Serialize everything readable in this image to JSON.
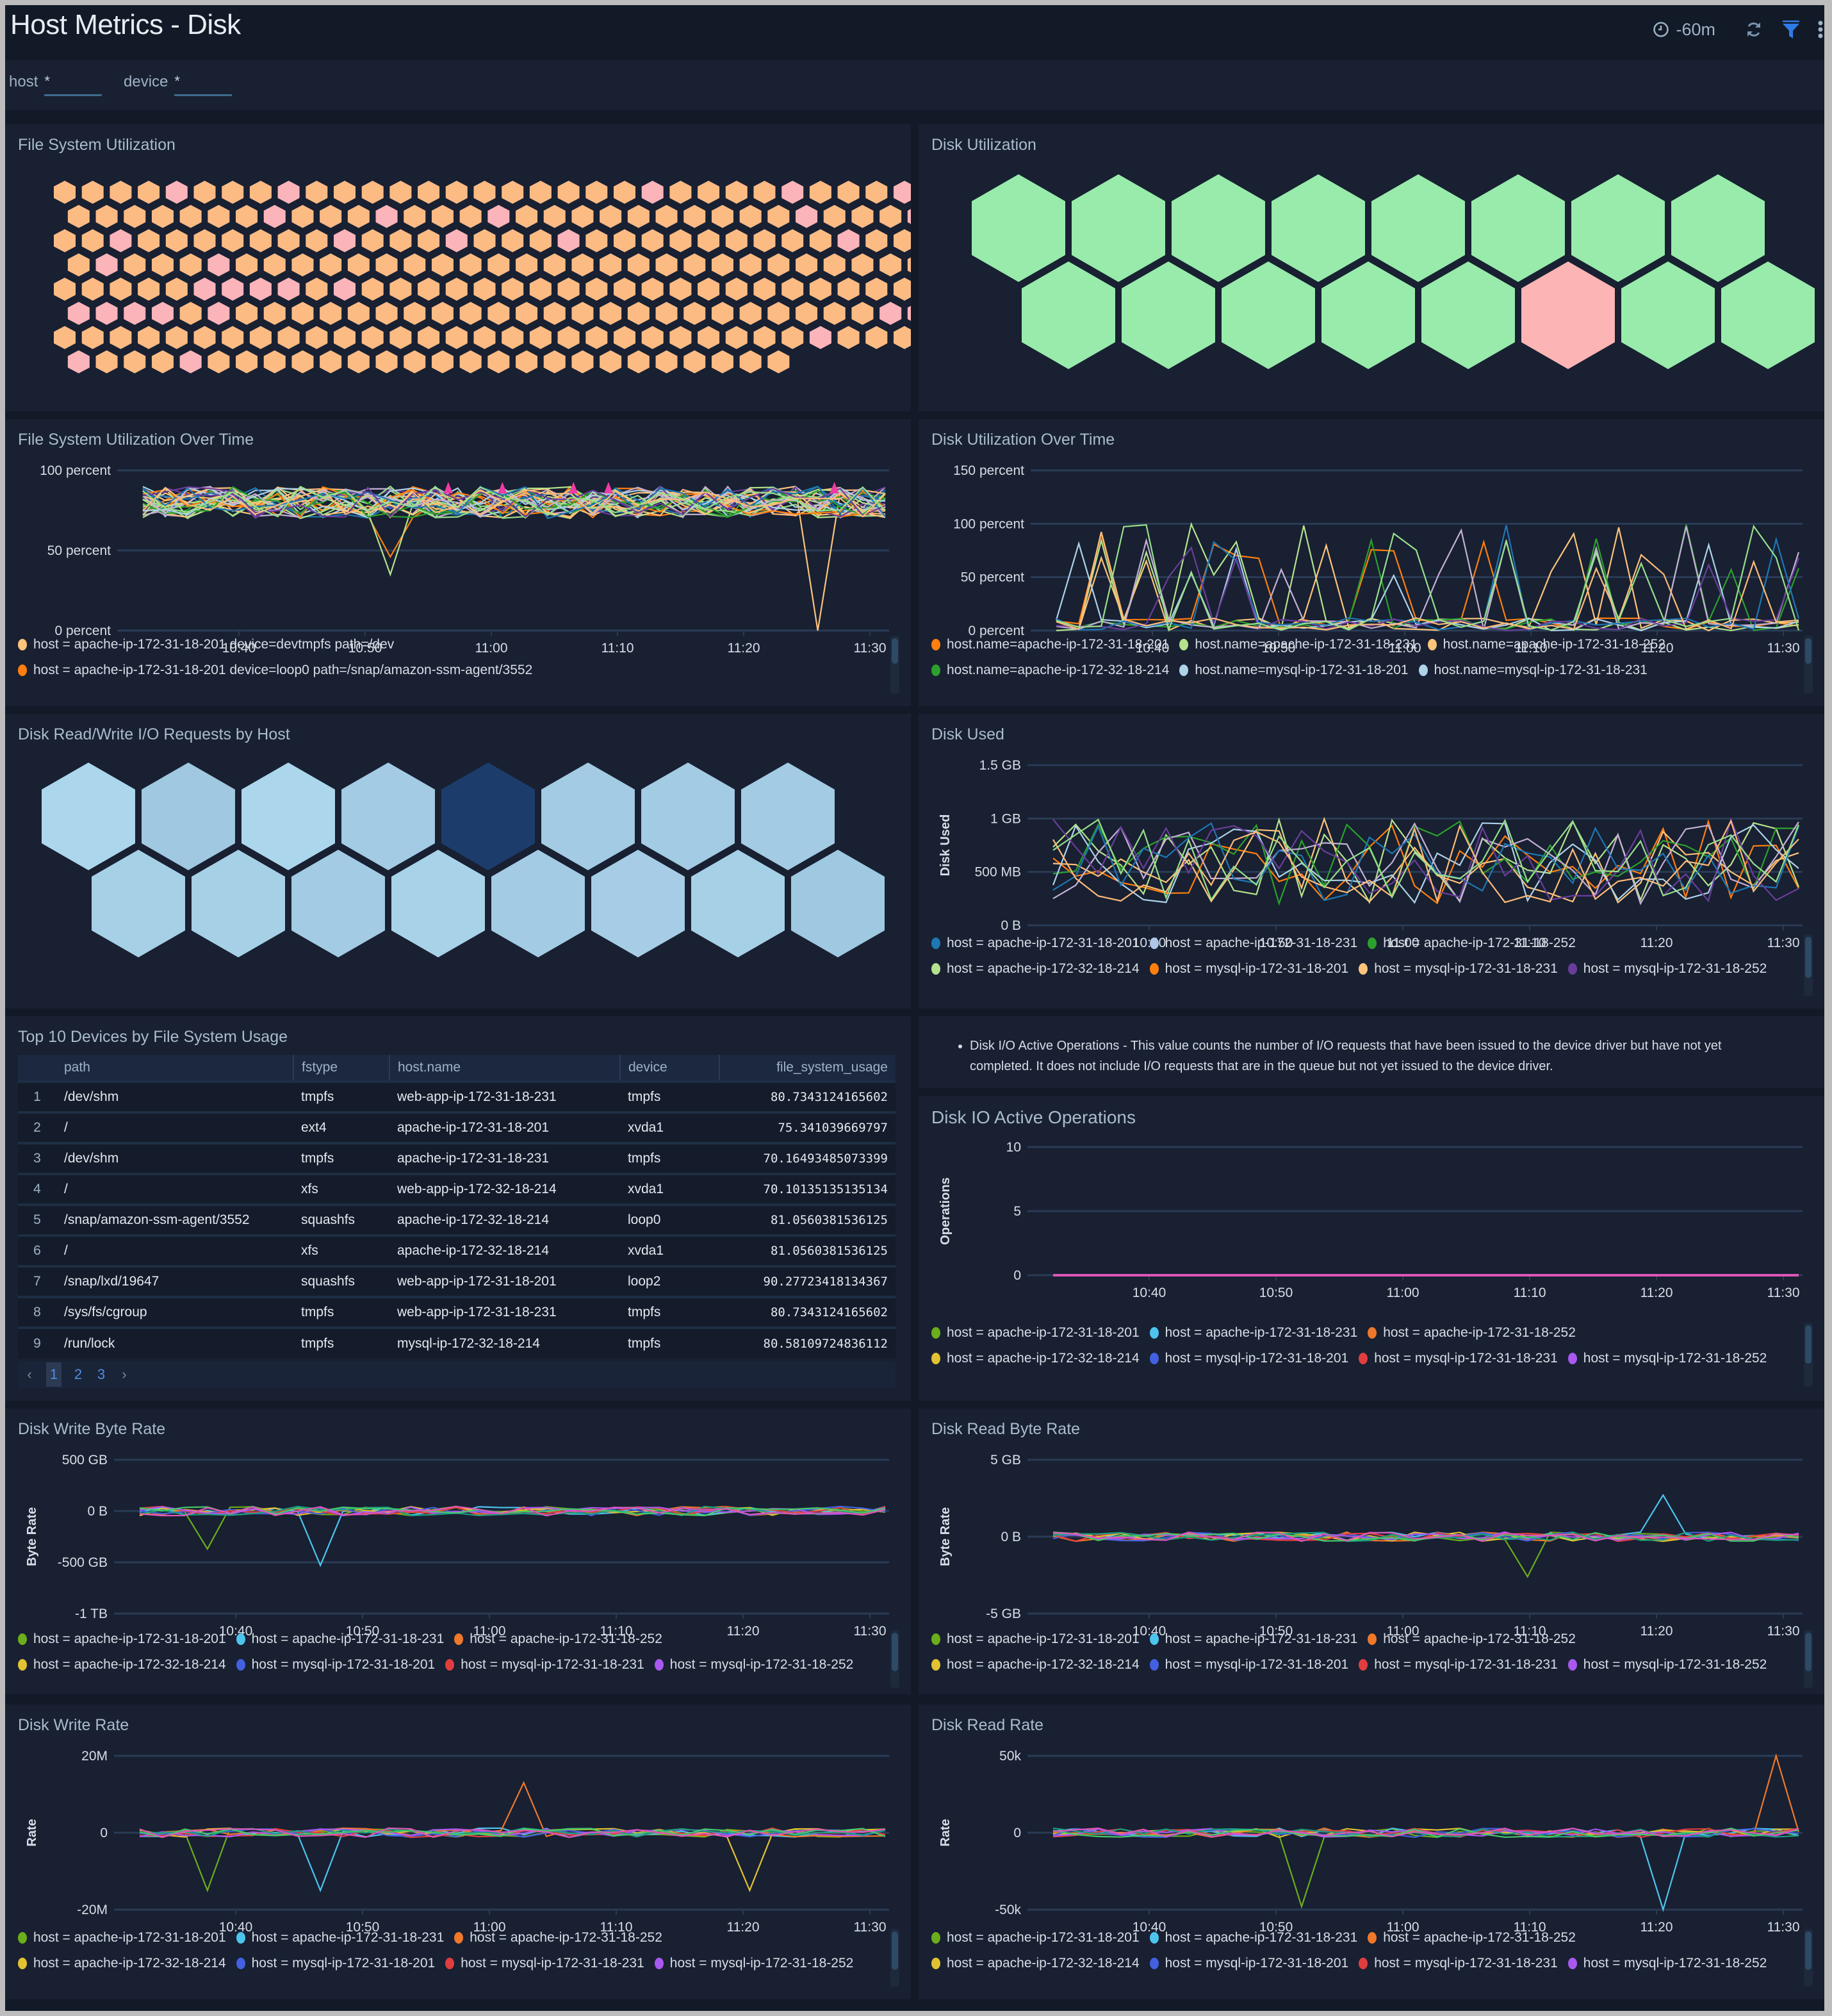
{
  "header": {
    "title": "Host Metrics - Disk",
    "time_range": "-60m",
    "icons": [
      "clock-icon",
      "refresh-icon",
      "filter-icon",
      "more-icon"
    ],
    "filter_color": "#2f7be6"
  },
  "filters": [
    {
      "label": "host",
      "value": "*"
    },
    {
      "label": "device",
      "value": "*"
    }
  ],
  "panels": {
    "fs_util": {
      "title": "File System Utilization",
      "colors": {
        "normal": "#fdbb84",
        "high": "#fbb4b9"
      },
      "rows": [
        "nnnnhnnnhnnnnnnnnnnnnhnnnnhnnnh",
        "nnnnnnnhnnnhnnnhnnnnnnnnnnhnnnhn",
        "nnhnnnnnnnhnnnhnnnhnnnnnnnnnhnn",
        "nhnnnhnnnnnnnnnnnnnnnnnnnnnnnnnn",
        "nnnnnhhhhnhnnnnnnnnnnnnnnnnnnnn",
        "hhhhnhnnnnnnnnnnnnnnnnnnnnnnnhh",
        "nnnnnnnnnnnnnnnnnnnnnnnnnnnhnnn",
        "hnnnhnnnnnnnnnnnnnnnnnnnnn"
      ]
    },
    "disk_util": {
      "title": "Disk Utilization",
      "colors": {
        "normal": "#98ebab",
        "high": "#fdb4b5"
      },
      "rows": [
        "nnnnnnnn",
        "nnnnnhnn"
      ]
    },
    "fs_util_time": {
      "title": "File System Utilization Over Time",
      "legend": [
        [
          {
            "label": "host = apache-ip-172-31-18-201 device=devtmpfs path=/dev",
            "color": "#fdc47b"
          }
        ],
        [
          {
            "label": "host = apache-ip-172-31-18-201 device=loop0 path=/snap/amazon-ssm-agent/3552",
            "color": "#ff7f0e"
          }
        ]
      ]
    },
    "disk_util_time": {
      "title": "Disk Utilization Over Time",
      "legend": [
        [
          {
            "label": "host.name=apache-ip-172-31-18-201",
            "color": "#ff7f0e"
          },
          {
            "label": "host.name=apache-ip-172-31-18-231",
            "color": "#b5e28c"
          },
          {
            "label": "host.name=apache-ip-172-31-18-252",
            "color": "#fdc47b"
          }
        ],
        [
          {
            "label": "host.name=apache-ip-172-32-18-214",
            "color": "#2ca02c"
          },
          {
            "label": "host.name=mysql-ip-172-31-18-201",
            "color": "#aed3e9"
          },
          {
            "label": "host.name=mysql-ip-172-31-18-231",
            "color": "#aed3e9"
          }
        ]
      ]
    },
    "io_requests": {
      "title": "Disk Read/Write I/O Requests by Host",
      "rows": [
        [
          "#acd6ec",
          "#a0c8e0",
          "#acd6ec",
          "#a3cbe3",
          "#1c3d6b",
          "#a3cbe3",
          "#a3cbe3",
          "#a3cbe3"
        ],
        [
          "#a6d0e6",
          "#a6d0e6",
          "#a3cbe3",
          "#a8d2e8",
          "#a3cbe3",
          "#a6cde5",
          "#a6d0e6",
          "#9fc9e0"
        ]
      ]
    },
    "disk_used": {
      "title": "Disk Used",
      "legend": [
        [
          {
            "label": "host = apache-ip-172-31-18-201",
            "color": "#1f77b4"
          },
          {
            "label": "host = apache-ip-172-31-18-231",
            "color": "#aec7e8"
          },
          {
            "label": "host = apache-ip-172-31-18-252",
            "color": "#2ca02c"
          }
        ],
        [
          {
            "label": "host = apache-ip-172-32-18-214",
            "color": "#b5e28c"
          },
          {
            "label": "host = mysql-ip-172-31-18-201",
            "color": "#ff7f0e"
          },
          {
            "label": "host = mysql-ip-172-31-18-231",
            "color": "#fdc47b"
          },
          {
            "label": "host = mysql-ip-172-31-18-252",
            "color": "#6a3d9a"
          }
        ]
      ]
    },
    "top_devices": {
      "title": "Top 10 Devices by File System Usage",
      "columns": [
        "",
        "path",
        "fstype",
        "host.name",
        "device",
        "file_system_usage"
      ],
      "rows": [
        [
          "1",
          "/dev/shm",
          "tmpfs",
          "web-app-ip-172-31-18-231",
          "tmpfs",
          "80.7343124165602"
        ],
        [
          "2",
          "/",
          "ext4",
          "apache-ip-172-31-18-201",
          "xvda1",
          "75.341039669797"
        ],
        [
          "3",
          "/dev/shm",
          "tmpfs",
          "apache-ip-172-31-18-231",
          "tmpfs",
          "70.16493485073399"
        ],
        [
          "4",
          "/",
          "xfs",
          "web-app-ip-172-32-18-214",
          "xvda1",
          "70.10135135135134"
        ],
        [
          "5",
          "/snap/amazon-ssm-agent/3552",
          "squashfs",
          "apache-ip-172-32-18-214",
          "loop0",
          "81.0560381536125"
        ],
        [
          "6",
          "/",
          "xfs",
          "apache-ip-172-32-18-214",
          "xvda1",
          "81.0560381536125"
        ],
        [
          "7",
          "/snap/lxd/19647",
          "squashfs",
          "web-app-ip-172-31-18-201",
          "loop2",
          "90.27723418134367"
        ],
        [
          "8",
          "/sys/fs/cgroup",
          "tmpfs",
          "web-app-ip-172-31-18-231",
          "tmpfs",
          "80.7343124165602"
        ],
        [
          "9",
          "/run/lock",
          "tmpfs",
          "mysql-ip-172-32-18-214",
          "tmpfs",
          "80.58109724836112"
        ]
      ],
      "pages": [
        "1",
        "2",
        "3"
      ],
      "current_page": "1"
    },
    "io_note": {
      "text": "Disk I/O Active Operations - This value counts the number of I/O requests that have been issued to the device driver but have not yet completed. It does not include I/O requests that are in the queue but not yet issued to the device driver."
    },
    "io_active": {
      "title": "Disk IO Active Operations"
    },
    "write_byte_rate": {
      "title": "Disk Write Byte Rate"
    },
    "read_byte_rate": {
      "title": "Disk Read Byte Rate"
    },
    "write_rate": {
      "title": "Disk Write Rate"
    },
    "read_rate": {
      "title": "Disk Read Rate"
    }
  },
  "host_legend": [
    [
      {
        "label": "host = apache-ip-172-31-18-201",
        "color": "#6bad1a"
      },
      {
        "label": "host = apache-ip-172-31-18-231",
        "color": "#4dc4ee"
      },
      {
        "label": "host = apache-ip-172-31-18-252",
        "color": "#f0782a"
      }
    ],
    [
      {
        "label": "host = apache-ip-172-32-18-214",
        "color": "#e3c232"
      },
      {
        "label": "host = mysql-ip-172-31-18-201",
        "color": "#4360e0"
      },
      {
        "label": "host = mysql-ip-172-31-18-231",
        "color": "#e03e3e"
      },
      {
        "label": "host = mysql-ip-172-31-18-252",
        "color": "#a958f0"
      }
    ]
  ],
  "chart_data": [
    {
      "id": "fs_util_time",
      "type": "line",
      "title": "File System Utilization Over Time",
      "x": [
        "10:40",
        "10:50",
        "11:00",
        "11:10",
        "11:20",
        "11:30"
      ],
      "yticks": [
        "0 percent",
        "50 percent",
        "100 percent"
      ],
      "ylim": [
        0,
        100
      ],
      "ylabel": "",
      "band": [
        70,
        90
      ],
      "dips": [
        {
          "t": 10.6,
          "v": 46
        },
        {
          "t": 11.1,
          "v": 35
        },
        {
          "t": 29.6,
          "v": 0
        }
      ],
      "markers": [
        38.8,
        43.9,
        50.6,
        53.9,
        75.2
      ]
    },
    {
      "id": "disk_util_time",
      "type": "line",
      "title": "Disk Utilization Over Time",
      "x": [
        "10:40",
        "10:50",
        "11:00",
        "11:10",
        "11:20",
        "11:30"
      ],
      "yticks": [
        "0 percent",
        "50 percent",
        "100 percent",
        "150 percent"
      ],
      "ylim": [
        0,
        150
      ],
      "ylabel": ""
    },
    {
      "id": "disk_used",
      "type": "line",
      "title": "Disk Used",
      "x": [
        "10:40",
        "10:50",
        "11:00",
        "11:10",
        "11:20",
        "11:30"
      ],
      "yticks": [
        "0 B",
        "500 MB",
        "1 GB",
        "1.5 GB"
      ],
      "ylim": [
        0,
        1.5
      ],
      "ylabel": "Disk Used"
    },
    {
      "id": "io_active",
      "type": "line",
      "title": "Disk IO Active Operations",
      "x": [
        "10:40",
        "10:50",
        "11:00",
        "11:10",
        "11:20",
        "11:30"
      ],
      "yticks": [
        "0",
        "5",
        "10"
      ],
      "ylim": [
        0,
        10
      ],
      "ylabel": "Operations",
      "note": "all series ≈ 0"
    },
    {
      "id": "write_byte_rate",
      "type": "line",
      "title": "Disk Write Byte Rate",
      "x": [
        "10:40",
        "10:50",
        "11:00",
        "11:10",
        "11:20",
        "11:30"
      ],
      "yticks": [
        "-1 TB",
        "-500 GB",
        "0 B",
        "500 GB"
      ],
      "ylim": [
        -1000,
        500
      ],
      "ylabel": "Byte Rate",
      "spikes": [
        {
          "t": 10.6,
          "v": -370
        },
        {
          "t": 10.75,
          "v": -530
        }
      ]
    },
    {
      "id": "read_byte_rate",
      "type": "line",
      "title": "Disk Read Byte Rate",
      "x": [
        "10:40",
        "10:50",
        "11:00",
        "11:10",
        "11:20",
        "11:30"
      ],
      "yticks": [
        "-5 GB",
        "0 B",
        "5 GB"
      ],
      "ylim": [
        -5,
        5
      ],
      "ylabel": "Byte Rate",
      "spikes": [
        {
          "t": 11.15,
          "v": -2.6
        },
        {
          "t": 11.33,
          "v": 2.7
        }
      ]
    },
    {
      "id": "write_rate",
      "type": "line",
      "title": "Disk Write Rate",
      "x": [
        "10:40",
        "10:50",
        "11:00",
        "11:10",
        "11:20",
        "11:30"
      ],
      "yticks": [
        "-20M",
        "0",
        "20M"
      ],
      "ylim": [
        -20,
        20
      ],
      "ylabel": "Rate",
      "spikes": [
        {
          "t": 10.58,
          "v": -15
        },
        {
          "t": 10.75,
          "v": -15
        },
        {
          "t": 11.0,
          "v": 13
        },
        {
          "t": 11.33,
          "v": -15
        }
      ]
    },
    {
      "id": "read_rate",
      "type": "line",
      "title": "Disk Read Rate",
      "x": [
        "10:40",
        "10:50",
        "11:00",
        "11:10",
        "11:20",
        "11:30"
      ],
      "yticks": [
        "-50k",
        "0",
        "50k"
      ],
      "ylim": [
        -50,
        50
      ],
      "ylabel": "Rate",
      "spikes": [
        {
          "t": 10.83,
          "v": -48
        },
        {
          "t": 11.33,
          "v": -50
        },
        {
          "t": 11.5,
          "v": 50
        }
      ]
    }
  ]
}
